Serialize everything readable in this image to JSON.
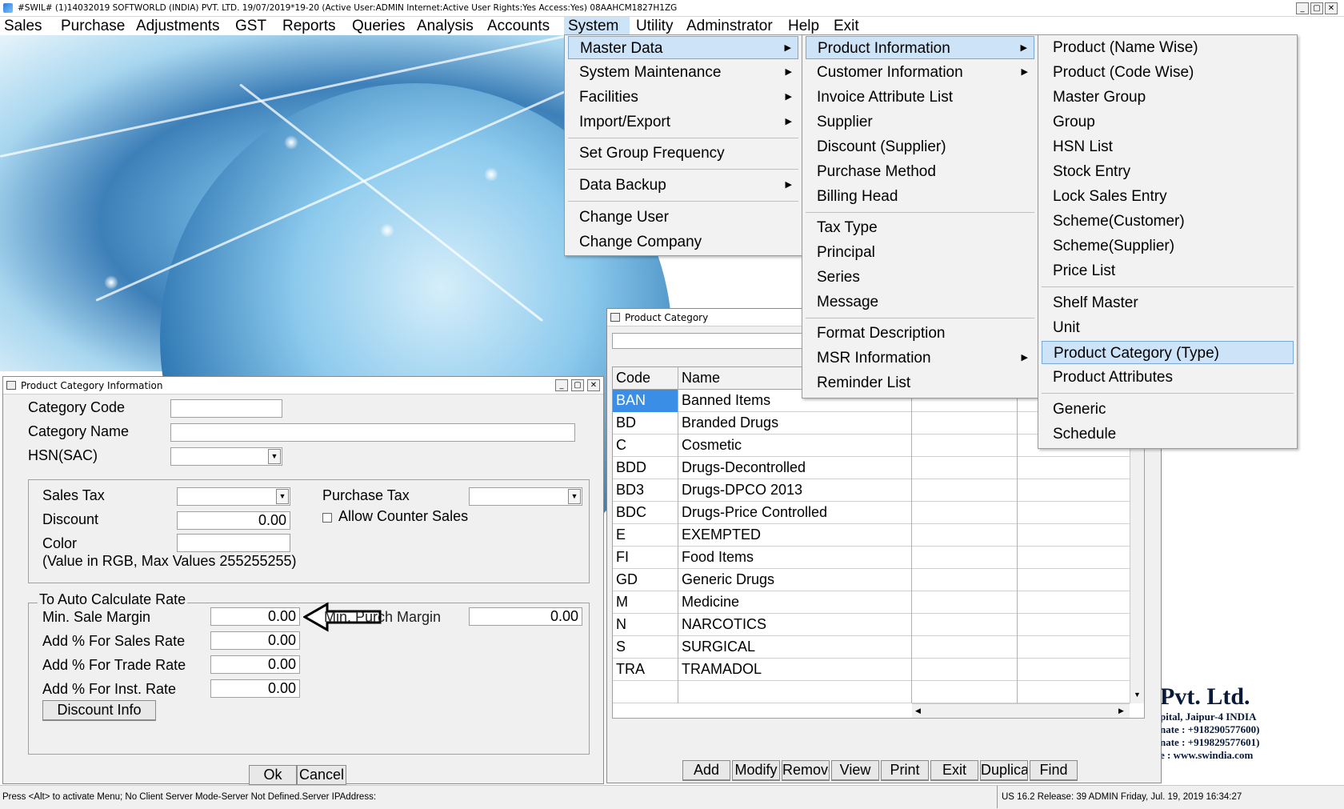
{
  "titlebar": {
    "text": "#SWIL#     (1)14032019 SOFTWORLD (INDIA) PVT. LTD.    19/07/2019*19-20     (Active User:ADMIN Internet:Active  User Rights:Yes Access:Yes) 08AAHCM1827H1ZG",
    "minimize": "_",
    "maximize": "▢",
    "close": "✕"
  },
  "menubar": {
    "items": [
      "Sales",
      "Purchase",
      "Adjustments",
      "GST",
      "Reports",
      "Queries",
      "Analysis",
      "Accounts",
      "System",
      "Utility",
      "Adminstrator",
      "Help",
      "Exit"
    ]
  },
  "system_menu": {
    "items": [
      "Master Data",
      "System Maintenance",
      "Facilities",
      "Import/Export",
      "Set Group Frequency",
      "Data Backup",
      "Change User",
      "Change Company"
    ]
  },
  "master_data_menu": {
    "items": [
      "Product Information",
      "Customer Information",
      "Invoice Attribute List",
      "Supplier",
      "Discount (Supplier)",
      "Purchase Method",
      "Billing Head",
      "Tax Type",
      "Principal",
      "Series",
      "Message",
      "Format Description",
      "MSR Information",
      "Reminder List"
    ]
  },
  "product_info_menu": {
    "items": [
      "Product (Name Wise)",
      "Product (Code Wise)",
      "Master Group",
      "Group",
      "HSN List",
      "Stock Entry",
      "Lock Sales Entry",
      "Scheme(Customer)",
      "Scheme(Supplier)",
      "Price List",
      "Shelf Master",
      "Unit",
      "Product Category (Type)",
      "Product Attributes",
      "Generic",
      "Schedule"
    ]
  },
  "category_form": {
    "title": "Product Category Information",
    "category_code_label": "Category Code",
    "category_name_label": "Category Name",
    "hsn_label": "HSN(SAC)",
    "sales_tax_label": "Sales Tax",
    "purchase_tax_label": "Purchase Tax",
    "discount_label": "Discount",
    "discount_value": "0.00",
    "allow_counter_sales_label": "Allow Counter Sales",
    "color_label": "Color",
    "color_hint": "(Value in RGB, Max Values 255255255)",
    "auto_calc_title": "To Auto Calculate Rate",
    "min_sale_margin_label": "Min. Sale Margin",
    "min_sale_margin_value": "0.00",
    "min_purch_margin_label": "Min. Purch Margin",
    "min_purch_margin_value": "0.00",
    "add_sales_rate_label": "Add % For Sales Rate",
    "add_sales_rate_value": "0.00",
    "add_trade_rate_label": "Add % For Trade Rate",
    "add_trade_rate_value": "0.00",
    "add_inst_rate_label": "Add % For Inst. Rate",
    "add_inst_rate_value": "0.00",
    "discount_info_button": "Discount Info",
    "ok_button": "Ok",
    "cancel_button": "Cancel"
  },
  "category_list": {
    "title": "Product Category",
    "headers": [
      "Code",
      "Name"
    ],
    "rows": [
      {
        "code": "BAN",
        "name": "Banned Items"
      },
      {
        "code": "BD",
        "name": "Branded Drugs"
      },
      {
        "code": "C",
        "name": "Cosmetic"
      },
      {
        "code": "BDD",
        "name": "Drugs-Decontrolled"
      },
      {
        "code": "BD3",
        "name": "Drugs-DPCO 2013"
      },
      {
        "code": "BDC",
        "name": "Drugs-Price Controlled"
      },
      {
        "code": "E",
        "name": "EXEMPTED"
      },
      {
        "code": "FI",
        "name": "Food Items"
      },
      {
        "code": "GD",
        "name": "Generic Drugs"
      },
      {
        "code": "M",
        "name": "Medicine"
      },
      {
        "code": "N",
        "name": "NARCOTICS"
      },
      {
        "code": "S",
        "name": "SURGICAL"
      },
      {
        "code": "TRA",
        "name": "TRAMADOL"
      }
    ],
    "buttons": [
      "Add",
      "Modify",
      "Remove",
      "View",
      "Print",
      "Exit",
      "Duplicate",
      "Find"
    ]
  },
  "company_banner": {
    "name": "Pvt. Ltd.",
    "line1": "pital, Jaipur-4 INDIA",
    "line2": "nate : +918290577600)",
    "line3": "nate : +919829577601)",
    "line4": "e : www.swindia.com"
  },
  "statusbar": {
    "left": "Press <Alt> to activate Menu; No Client Server Mode-Server Not Defined.Server IPAddress:",
    "right": "US 16.2 Release: 39 ADMIN  Friday, Jul. 19, 2019  16:34:27"
  },
  "colors": {
    "highlight": "#cde3f7",
    "grid_selected": "#3a8ee6"
  }
}
